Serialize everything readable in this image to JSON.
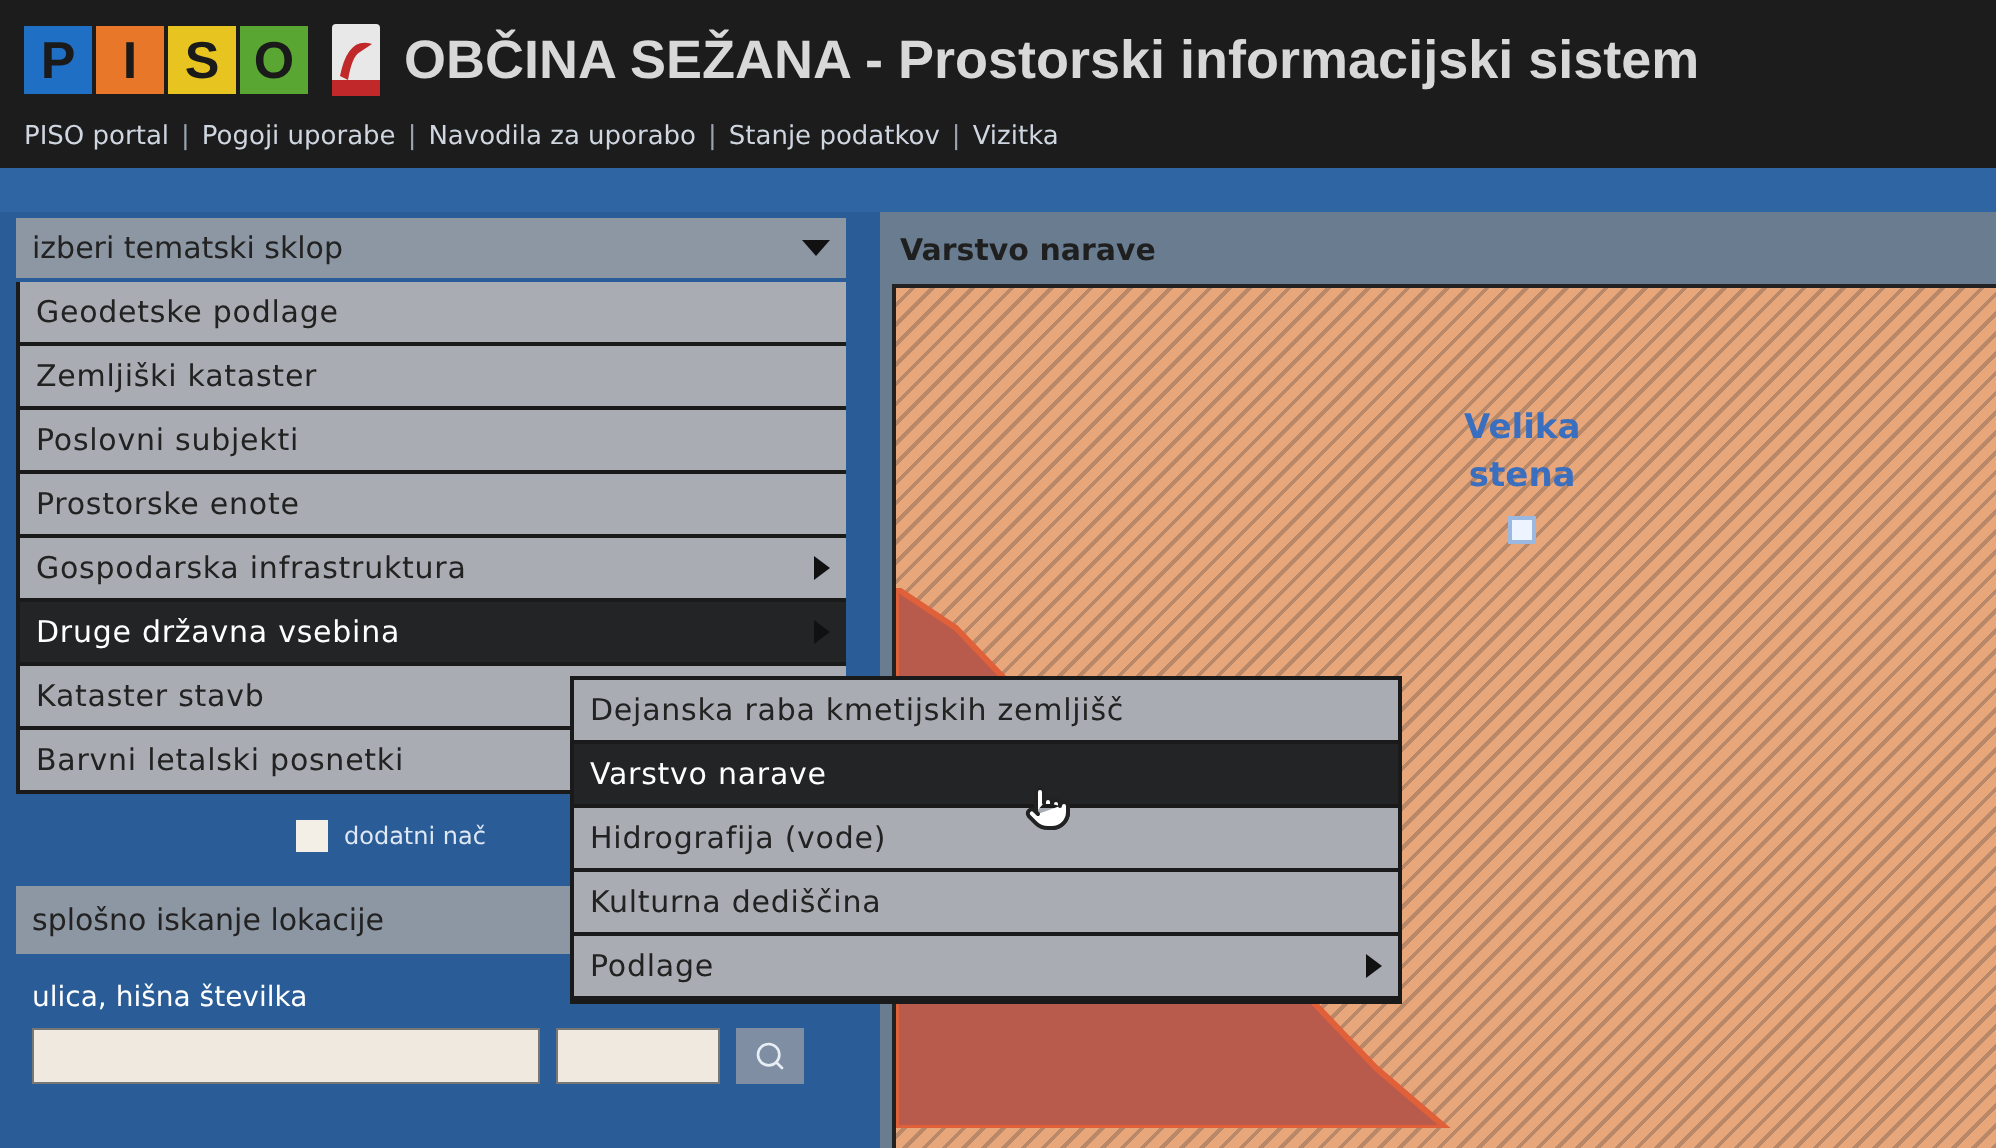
{
  "header": {
    "logo_letters": [
      {
        "text": "P",
        "color": "#1f6fc4"
      },
      {
        "text": "I",
        "color": "#e8772a"
      },
      {
        "text": "S",
        "color": "#e8c420"
      },
      {
        "text": "O",
        "color": "#5aa632"
      }
    ],
    "title": "OBČINA SEŽANA - Prostorski informacijski sistem",
    "links": [
      {
        "kind": "link",
        "text": "PISO portal"
      },
      {
        "kind": "separator",
        "text": "|"
      },
      {
        "kind": "link",
        "text": "Pogoji uporabe"
      },
      {
        "kind": "separator",
        "text": "|"
      },
      {
        "kind": "link",
        "text": "Navodila za uporabo"
      },
      {
        "kind": "separator",
        "text": "|"
      },
      {
        "kind": "link",
        "text": "Stanje podatkov"
      },
      {
        "kind": "separator",
        "text": "|"
      },
      {
        "kind": "link",
        "text": "Vizitka"
      }
    ]
  },
  "theme_select": {
    "label": "izberi tematski sklop"
  },
  "theme_menu": [
    {
      "label": "Geodetske podlage",
      "submenu": false,
      "selected": false
    },
    {
      "label": "Zemljiški kataster",
      "submenu": false,
      "selected": false
    },
    {
      "label": "Poslovni subjekti",
      "submenu": false,
      "selected": false
    },
    {
      "label": "Prostorske enote",
      "submenu": false,
      "selected": false
    },
    {
      "label": "Gospodarska infrastruktura",
      "submenu": true,
      "selected": false
    },
    {
      "label": "Druge državna vsebina",
      "submenu": true,
      "selected": true
    },
    {
      "label": "Kataster stavb",
      "submenu": false,
      "selected": false
    },
    {
      "label": "Barvni letalski posnetki",
      "submenu": false,
      "selected": false
    }
  ],
  "submenu": [
    {
      "label": "Dejanska raba kmetijskih zemljišč",
      "submenu": false,
      "selected": false
    },
    {
      "label": "Varstvo narave",
      "submenu": false,
      "selected": true
    },
    {
      "label": "Hidrografija (vode)",
      "submenu": false,
      "selected": false
    },
    {
      "label": "Kulturna dediščina",
      "submenu": false,
      "selected": false
    },
    {
      "label": "Podlage",
      "submenu": true,
      "selected": false
    }
  ],
  "extra_option": {
    "label": "dodatni nač",
    "checked": false
  },
  "search": {
    "title": "splošno iskanje lokacije",
    "field_label": "ulica, hišna številka"
  },
  "map": {
    "title": "Varstvo narave",
    "place_label": [
      "Velika",
      "stena"
    ]
  }
}
